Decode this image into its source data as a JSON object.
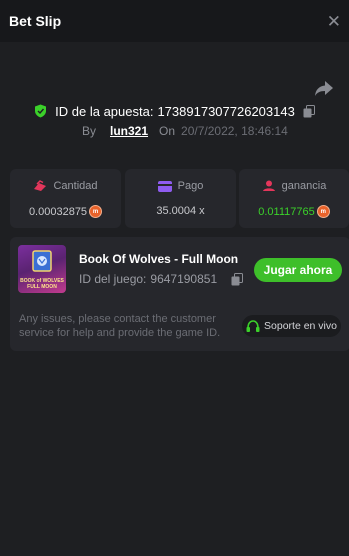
{
  "header": {
    "title": "Bet Slip",
    "close_icon": "close-icon"
  },
  "bet": {
    "id_label": "ID de la apuesta:",
    "id_value": "1738917307726203143",
    "by_label": "By",
    "user": "lun321",
    "on_label": "On",
    "date": "20/7/2022, 18:46:14"
  },
  "stats": {
    "amount": {
      "label": "Cantidad",
      "value": "0.00032875",
      "icon": "coins-icon"
    },
    "payout": {
      "label": "Pago",
      "value": "35.0004 x",
      "icon": "card-icon"
    },
    "profit": {
      "label": "ganancia",
      "value": "0.01117765",
      "icon": "profit-icon"
    }
  },
  "game": {
    "name": "Book Of Wolves - Full Moon",
    "thumb_text_1": "BOOK of WOLVES",
    "thumb_text_2": "FULL MOON",
    "id_label": "ID del juego:",
    "id_value": "9647190851",
    "play_label": "Jugar ahora"
  },
  "help": {
    "text": "Any issues, please contact the customer service for help and provide the game ID.",
    "support_label": "Soporte en vivo"
  },
  "colors": {
    "background": "#1e1f22",
    "card": "#26272c",
    "accent_green": "#3ebf2a",
    "profit_green": "#3bd12a",
    "coin_orange": "#e8622a"
  }
}
